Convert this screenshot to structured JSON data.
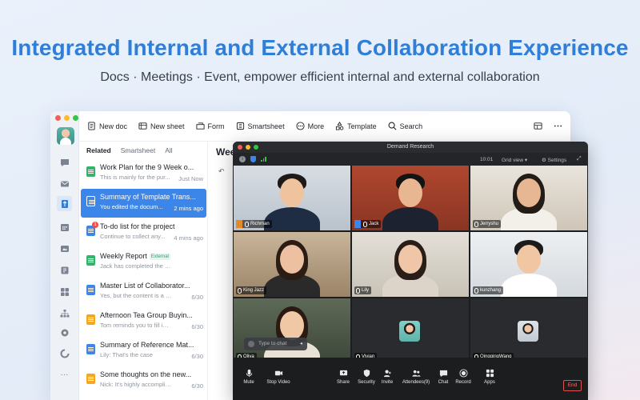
{
  "hero": {
    "title": "Integrated Internal and External Collaboration Experience",
    "subtitle": "Docs · Meetings · Event, empower efficient internal and external collaboration"
  },
  "colors": {
    "accent": "#2f7fd9",
    "selected": "#3b86e8",
    "end": "#e0534d"
  },
  "toolbar": {
    "new_doc": "New doc",
    "new_sheet": "New sheet",
    "form": "Form",
    "smartsheet": "Smartsheet",
    "more": "More",
    "template": "Template",
    "search": "Search"
  },
  "tabs": [
    "Related",
    "Smartsheet",
    "All"
  ],
  "docs": [
    {
      "title": "Work Plan for the 9 Week o...",
      "desc": "This is mainly for the pur...",
      "time": "Just Now",
      "icon": "sheet-icon",
      "color": "#34b36b"
    },
    {
      "title": "Summary of Template Trans...",
      "desc": "You edited the docum...",
      "time": "2 mins ago",
      "icon": "doc-icon",
      "color": "#ffffff"
    },
    {
      "title": "To-do list for the project",
      "desc": "Continue to collect any...",
      "time": "4 mins ago",
      "icon": "doc-icon",
      "color": "#3b86e8",
      "badge": "1"
    },
    {
      "title": "Weekly Report",
      "desc": "Jack has completed the to-do i...",
      "time": "",
      "icon": "sheet-icon",
      "color": "#34b36b",
      "tag": "External"
    },
    {
      "title": "Master List of Collaborator...",
      "desc": "Yes, but the content is a bit...",
      "time": "6/30",
      "icon": "doc-icon",
      "color": "#3b86e8"
    },
    {
      "title": "Afternoon Tea Group Buyin...",
      "desc": "Tom reminds you to fill in the...",
      "time": "6/30",
      "icon": "form-icon",
      "color": "#f5a623"
    },
    {
      "title": "Summary of Reference Mat...",
      "desc": "Lily: That's the case",
      "time": "6/30",
      "icon": "doc-icon",
      "color": "#3b86e8"
    },
    {
      "title": "Some thoughts on the new...",
      "desc": "Nick: It's highly accomplished...",
      "time": "6/30",
      "icon": "form-icon",
      "color": "#f5a623"
    }
  ],
  "editor": {
    "title": "Wee"
  },
  "meeting": {
    "title": "Demand Research",
    "timer": "10:01",
    "view": "Grid view",
    "settings": "Settings",
    "participants": [
      "Richman",
      "Jack",
      "Jerryshu",
      "King Jazz",
      "Lily",
      "kunzhang",
      "Oliva",
      "Vivian",
      "QingqingWang"
    ],
    "chat_placeholder": "Type to chat",
    "controls": [
      "Mute",
      "Stop Video",
      "Share",
      "Security",
      "Invite",
      "Attendees(9)",
      "Chat",
      "Record",
      "Apps"
    ],
    "end": "End"
  }
}
